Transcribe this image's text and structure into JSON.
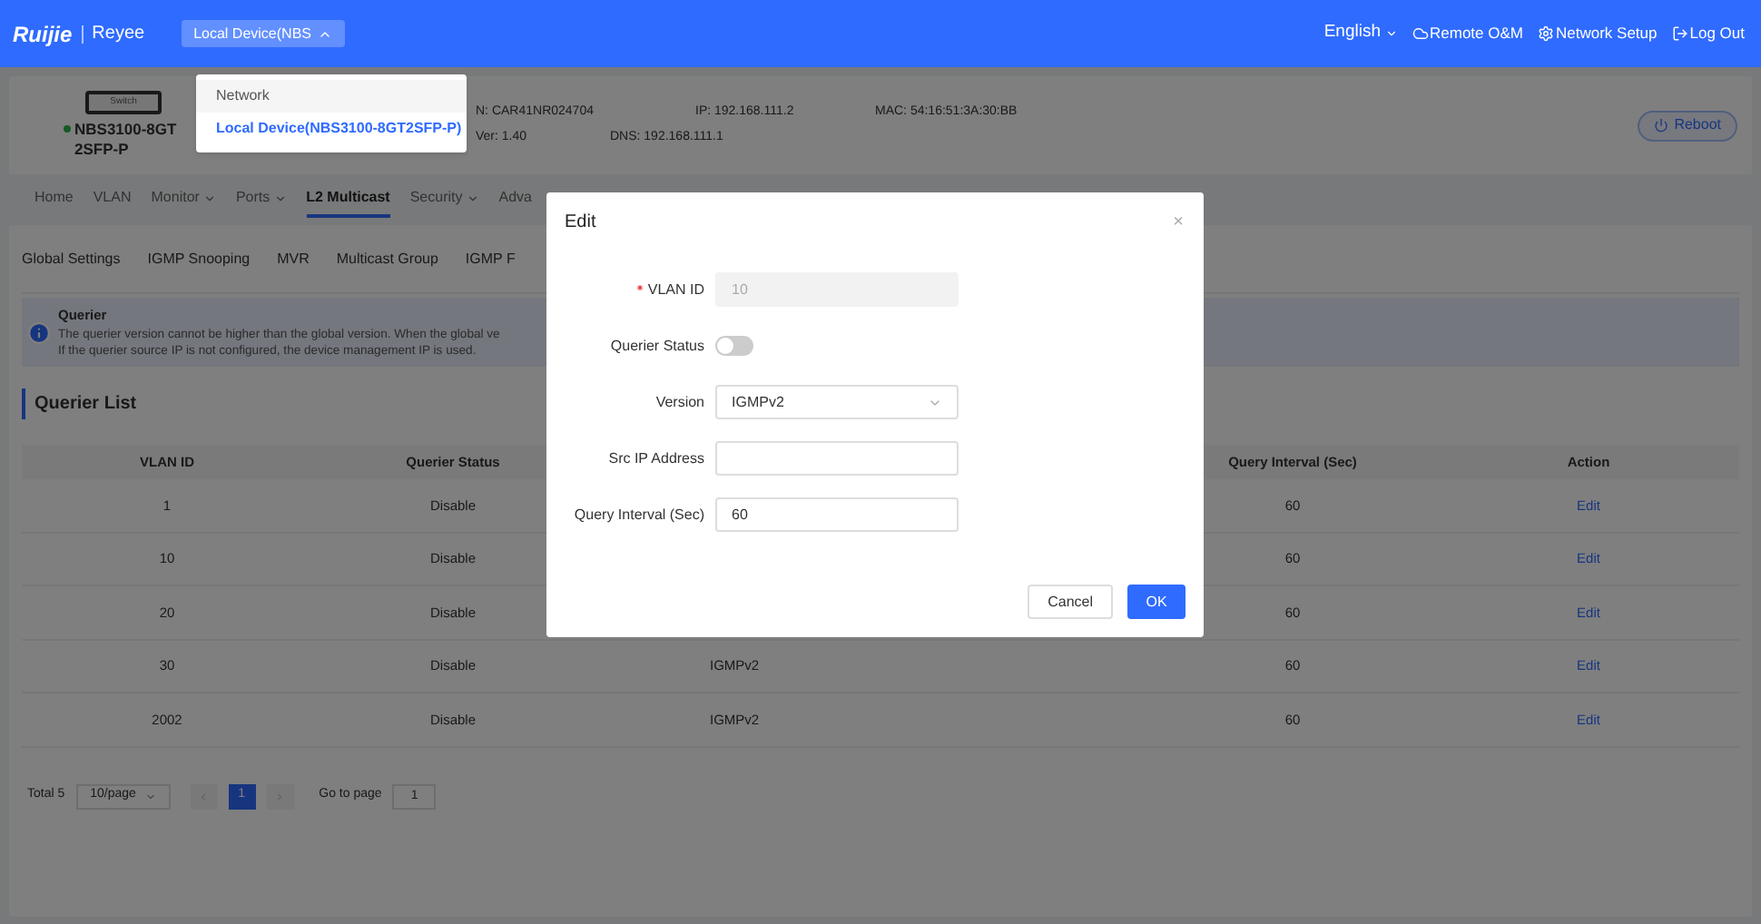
{
  "header": {
    "brand": "Ruijie",
    "sub_brand": "Reyee",
    "device_button": "Local Device(NBS",
    "language": "English",
    "links": [
      {
        "kind": "cloud",
        "label": "Remote O&M"
      },
      {
        "kind": "setup",
        "label": "Network Setup"
      },
      {
        "kind": "logout",
        "label": "Log Out"
      }
    ]
  },
  "device_menu": {
    "group": "Network",
    "item": "Local Device(NBS3100-8GT2SFP-P)"
  },
  "device": {
    "icon_label": "Switch",
    "name": "NBS3100-8GT2SFP-P",
    "online": true,
    "sn": "N: CAR41NR024704",
    "ver": "Ver: 1.40",
    "ip": "IP: 192.168.111.2",
    "dns": "DNS: 192.168.111.1",
    "mac": "MAC: 54:16:51:3A:30:BB",
    "reboot": "Reboot"
  },
  "nav": [
    {
      "label": "Home",
      "caret": false,
      "selected": false
    },
    {
      "label": "VLAN",
      "caret": false,
      "selected": false
    },
    {
      "label": "Monitor",
      "caret": true,
      "selected": false
    },
    {
      "label": "Ports",
      "caret": true,
      "selected": false
    },
    {
      "label": "L2 Multicast",
      "caret": false,
      "selected": true
    },
    {
      "label": "Security",
      "caret": true,
      "selected": false
    },
    {
      "label": "Adva",
      "caret": false,
      "selected": false
    }
  ],
  "sub_tabs": [
    {
      "label": "Global Settings",
      "selected": false
    },
    {
      "label": "IGMP Snooping",
      "selected": false
    },
    {
      "label": "MVR",
      "selected": false
    },
    {
      "label": "Multicast Group",
      "selected": false
    },
    {
      "label": "IGMP F",
      "selected": false
    }
  ],
  "notice": {
    "title": "Querier",
    "lines": [
      "The querier version cannot be higher than the global version. When the global ve",
      "If the querier source IP is not configured, the device management IP is used."
    ]
  },
  "list_title": "Querier List",
  "table": {
    "columns": [
      "VLAN ID",
      "Querier Status",
      "Query Interval (Sec)",
      "Action"
    ],
    "rows": [
      {
        "vlan": "1",
        "status": "Disable",
        "interval": "60",
        "action": "Edit"
      },
      {
        "vlan": "10",
        "status": "Disable",
        "interval": "60",
        "action": "Edit"
      },
      {
        "vlan": "20",
        "status": "Disable",
        "interval": "60",
        "action": "Edit"
      },
      {
        "vlan": "30",
        "status": "Disable",
        "version": "IGMPv2",
        "interval": "60",
        "action": "Edit"
      },
      {
        "vlan": "2002",
        "status": "Disable",
        "version": "IGMPv2",
        "interval": "60",
        "action": "Edit"
      }
    ]
  },
  "pagination": {
    "total": "Total 5",
    "page_size": "10/page",
    "pages": [
      {
        "label": "1",
        "selected": true
      }
    ],
    "goto_label": "Go to page",
    "goto_value": "1"
  },
  "dialog": {
    "title": "Edit",
    "close": "×",
    "fields": [
      {
        "kind": "input",
        "label": "VLAN ID",
        "required": true,
        "disabled": true,
        "value": "10"
      },
      {
        "kind": "switch",
        "label": "Querier Status",
        "required": false,
        "on": false
      },
      {
        "kind": "select",
        "label": "Version",
        "required": false,
        "value": "IGMPv2"
      },
      {
        "kind": "input",
        "label": "Src IP Address",
        "required": false,
        "disabled": false
      },
      {
        "kind": "input",
        "label": "Query Interval (Sec)",
        "required": false,
        "disabled": false,
        "value": "60"
      }
    ],
    "cancel": "Cancel",
    "ok": "OK"
  }
}
